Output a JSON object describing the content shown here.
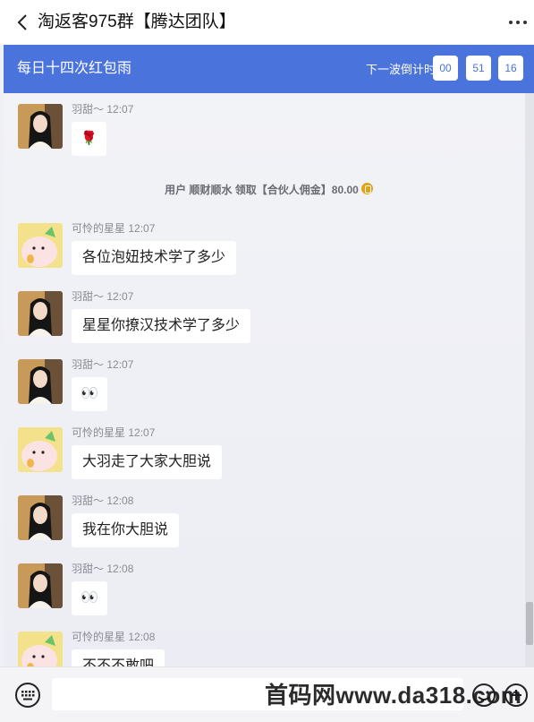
{
  "header": {
    "title": "淘返客975群【腾达团队】",
    "back_icon": "chevron-left-icon",
    "more_icon": "ellipsis-icon"
  },
  "banner": {
    "title": "每日十四次红包雨",
    "countdown_label": "下一波倒计时",
    "countdown": [
      "00",
      "51",
      "16"
    ],
    "color": "#4a74dc"
  },
  "messages": [
    {
      "sender": "羽甜～",
      "time": "12:07",
      "content": "🌹",
      "avatar": "girl"
    },
    {
      "sender": "可怜的星星",
      "time": "12:07",
      "content": "各位泡妞技术学了多少",
      "avatar": "cartoon"
    },
    {
      "sender": "羽甜～",
      "time": "12:07",
      "content": "星星你撩汉技术学了多少",
      "avatar": "girl"
    },
    {
      "sender": "羽甜～",
      "time": "12:07",
      "content": "👀",
      "avatar": "girl"
    },
    {
      "sender": "可怜的星星",
      "time": "12:07",
      "content": "大羽走了大家大胆说",
      "avatar": "cartoon"
    },
    {
      "sender": "羽甜～",
      "time": "12:08",
      "content": "我在你大胆说",
      "avatar": "girl"
    },
    {
      "sender": "羽甜～",
      "time": "12:08",
      "content": "👀",
      "avatar": "girl"
    },
    {
      "sender": "可怜的星星",
      "time": "12:08",
      "content": "不不不敢吧",
      "avatar": "cartoon"
    }
  ],
  "system_message": "用户 顺财顺水 领取【合伙人佣金】80.00",
  "input": {
    "placeholder": "",
    "value": ""
  },
  "watermark": "首码网www.da318.com"
}
